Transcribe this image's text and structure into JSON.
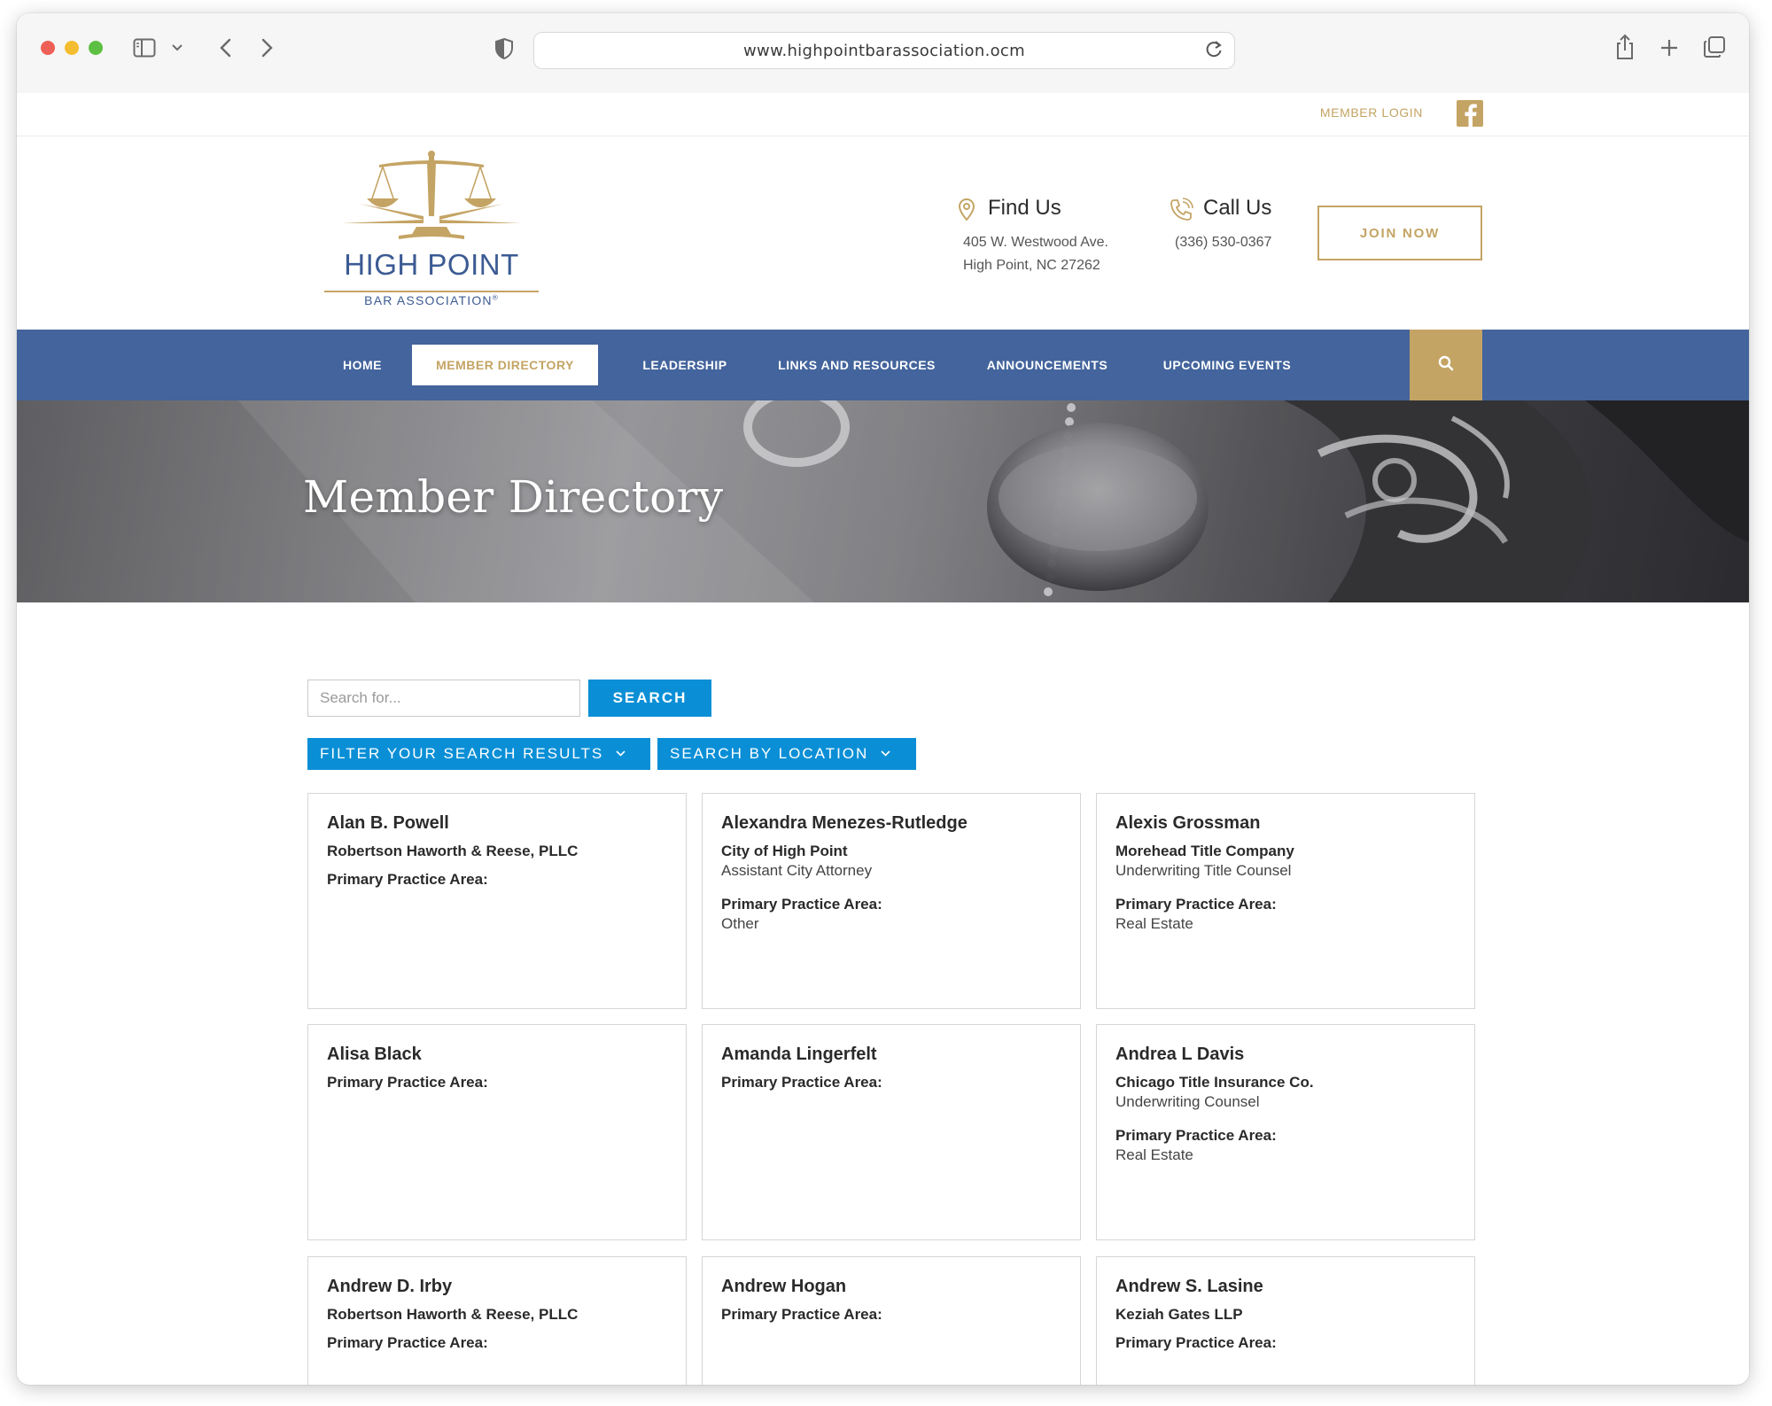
{
  "browser": {
    "url": "www.highpointbarassociation.ocm"
  },
  "utility": {
    "member_login": "MEMBER LOGIN"
  },
  "logo": {
    "main": "HIGH POINT",
    "sub": "BAR ASSOCIATION",
    "mark": "®"
  },
  "contact": {
    "find_us": {
      "title": "Find Us",
      "line1": "405 W. Westwood Ave.",
      "line2": "High Point, NC 27262"
    },
    "call_us": {
      "title": "Call Us",
      "line1": "(336) 530-0367"
    }
  },
  "join_label": "JOIN NOW",
  "nav": {
    "items": [
      {
        "label": "HOME"
      },
      {
        "label": "MEMBER DIRECTORY"
      },
      {
        "label": "LEADERSHIP"
      },
      {
        "label": "LINKS AND RESOURCES"
      },
      {
        "label": "ANNOUNCEMENTS"
      },
      {
        "label": "UPCOMING EVENTS"
      }
    ],
    "active_index": 1
  },
  "hero": {
    "title": "Member Directory"
  },
  "search": {
    "placeholder": "Search for...",
    "button": "SEARCH",
    "filter": "FILTER YOUR SEARCH RESULTS",
    "location": "SEARCH BY LOCATION"
  },
  "practice_label": "Primary Practice Area:",
  "members": [
    {
      "name": "Alan B. Powell",
      "company": "Robertson Haworth & Reese, PLLC",
      "title": "",
      "practice": ""
    },
    {
      "name": "Alexandra Menezes-Rutledge",
      "company": "City of High Point",
      "title": "Assistant City Attorney",
      "practice": "Other"
    },
    {
      "name": "Alexis Grossman",
      "company": "Morehead Title Company",
      "title": "Underwriting Title Counsel",
      "practice": "Real Estate"
    },
    {
      "name": "Alisa Black",
      "company": "",
      "title": "",
      "practice": ""
    },
    {
      "name": "Amanda Lingerfelt",
      "company": "",
      "title": "",
      "practice": ""
    },
    {
      "name": "Andrea L Davis",
      "company": "Chicago Title Insurance Co.",
      "title": "Underwriting Counsel",
      "practice": "Real Estate"
    },
    {
      "name": "Andrew D. Irby",
      "company": "Robertson Haworth & Reese, PLLC",
      "title": "",
      "practice": ""
    },
    {
      "name": "Andrew Hogan",
      "company": "",
      "title": "",
      "practice": ""
    },
    {
      "name": "Andrew S. Lasine",
      "company": "Keziah Gates LLP",
      "title": "",
      "practice": ""
    }
  ],
  "colors": {
    "nav_blue": "#43649c",
    "gold": "#c4a464",
    "search_blue": "#0a8fd6"
  }
}
